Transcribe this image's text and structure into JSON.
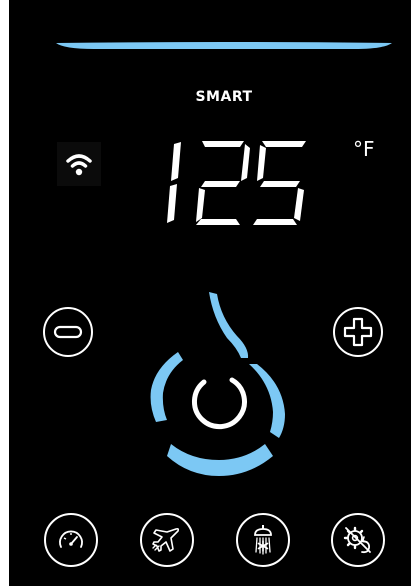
{
  "colors": {
    "accent": "#7cc8f4",
    "background": "#000000",
    "foreground": "#ffffff"
  },
  "header": {
    "mode_label": "SMART"
  },
  "display": {
    "temperature": "125",
    "unit": "°F"
  },
  "icons": {
    "wifi": "wifi-icon",
    "minus": "minus-icon",
    "plus": "plus-icon",
    "speedometer": "speedometer-icon",
    "airplane": "airplane-icon",
    "shower": "snowflake-shower-icon",
    "reset": "gear-reset-icon",
    "dial": "flame-dial-icon"
  }
}
